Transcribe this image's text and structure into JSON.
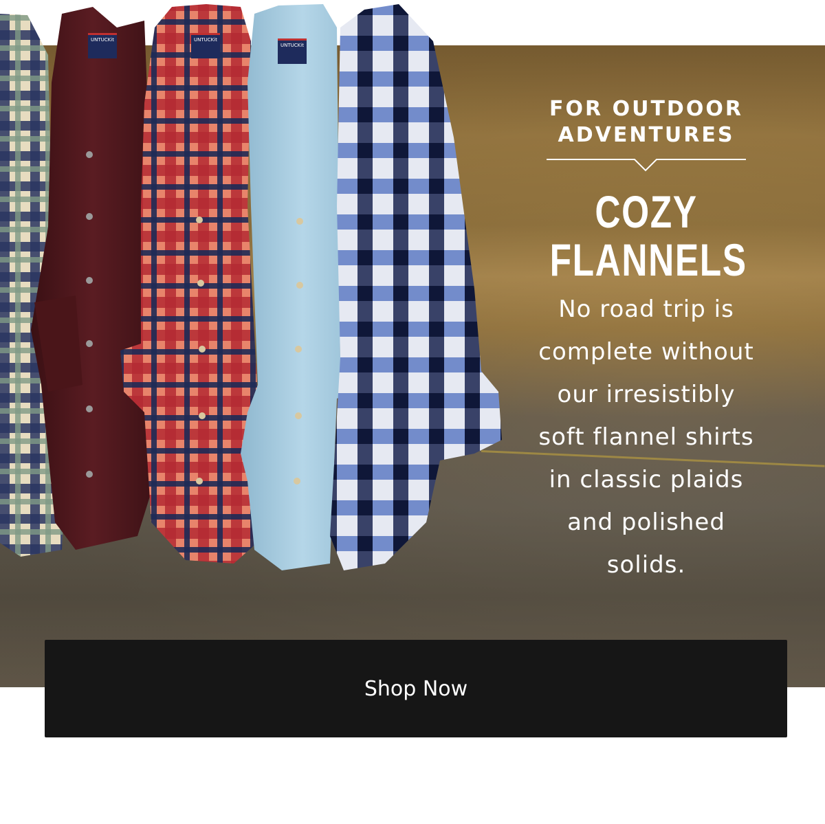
{
  "hero": {
    "eyebrow_line1": "FOR OUTDOOR",
    "eyebrow_line2": "ADVENTURES",
    "title_line1": "COZY",
    "title_line2": "FLANNELS",
    "body_lines": [
      "No road trip is",
      "complete without",
      "our irresistibly",
      "soft flannel shirts",
      "in classic plaids",
      "and polished",
      "solids."
    ]
  },
  "shirt_labels": [
    "UNTUCKit",
    "UNTUCKit",
    "UNTUCKit"
  ],
  "cta": {
    "label": "Shop Now"
  },
  "colors": {
    "cta_bg": "#161616",
    "text_light": "#ffffff",
    "desert": "#a78448",
    "burgundy": "#4a1619",
    "light_blue": "#a9cde0",
    "navy": "#1f2a55"
  }
}
